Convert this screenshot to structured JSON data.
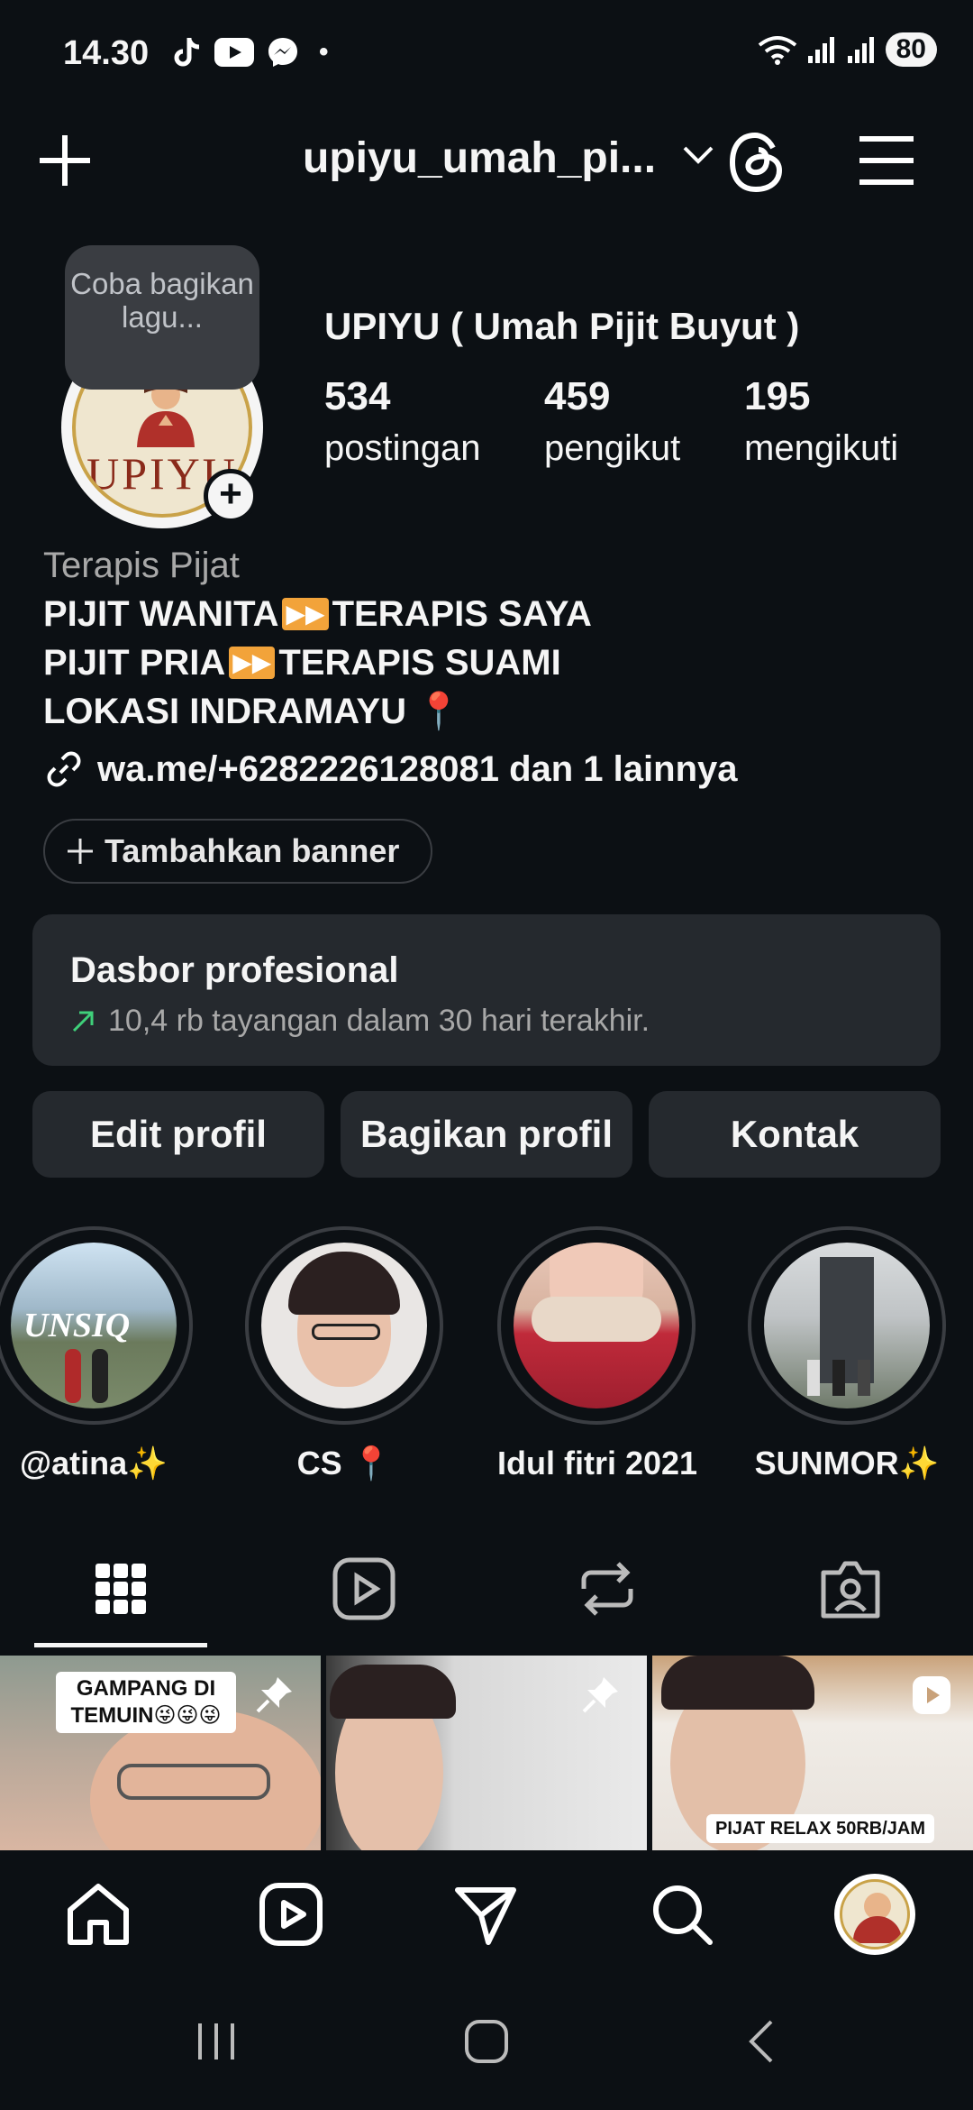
{
  "status_bar": {
    "time": "14.30",
    "battery": "80",
    "icons": [
      "tiktok-icon",
      "youtube-icon",
      "messenger-icon",
      "dot-icon",
      "wifi-icon",
      "signal-icon",
      "signal-icon"
    ]
  },
  "header": {
    "username": "upiyu_umah_pi...",
    "icons": [
      "plus-icon",
      "chevron-down-icon",
      "threads-icon",
      "menu-icon"
    ]
  },
  "profile": {
    "note_bubble": "Coba bagikan lagu...",
    "avatar_logo_text": "UPIYU",
    "display_name": "UPIYU ( Umah Pijit Buyut )",
    "stats": [
      {
        "value": "534",
        "label": "postingan"
      },
      {
        "value": "459",
        "label": "pengikut"
      },
      {
        "value": "195",
        "label": "mengikuti"
      }
    ],
    "category": "Terapis Pijat",
    "bio": {
      "line1_a": "PIJIT WANITA",
      "line1_b": "TERAPIS SAYA",
      "line2_a": "PIJIT PRIA",
      "line2_b": "TERAPIS SUAMI",
      "line3": "LOKASI INDRAMAYU 📍"
    },
    "link": "wa.me/+6282226128081 dan 1 lainnya",
    "banner_button": "Tambahkan banner"
  },
  "dashboard": {
    "title": "Dasbor profesional",
    "subtitle": "10,4 rb tayangan dalam 30 hari terakhir."
  },
  "actions": {
    "edit": "Edit profil",
    "share": "Bagikan profil",
    "contact": "Kontak"
  },
  "highlights": [
    {
      "label": "@atina✨",
      "image_text": "UNSIQ"
    },
    {
      "label": "CS 📍"
    },
    {
      "label": "Idul fitri 2021"
    },
    {
      "label": "SUNMOR✨"
    }
  ],
  "tabs": [
    "grid-icon",
    "reels-icon",
    "reposts-icon",
    "tagged-icon"
  ],
  "posts": [
    {
      "caption": "GAMPANG DI TEMUIN😜😜😜",
      "pinned": true
    },
    {
      "caption": "",
      "pinned": true
    },
    {
      "caption": "PIJAT RELAX 50RB/JAM",
      "reel": true
    }
  ],
  "bottom_nav": [
    "home-icon",
    "reels-icon",
    "messages-icon",
    "search-icon",
    "profile-avatar"
  ],
  "system_nav": [
    "recents-icon",
    "home-button-icon",
    "back-icon"
  ]
}
